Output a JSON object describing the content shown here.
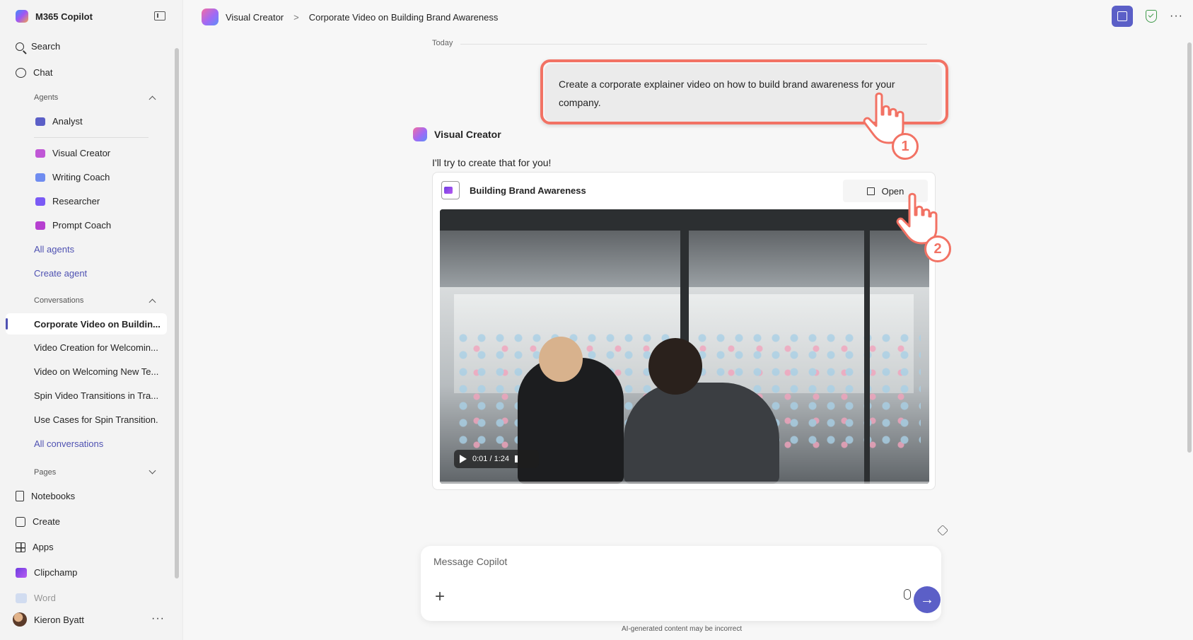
{
  "app": {
    "title": "M365 Copilot"
  },
  "nav": {
    "search": "Search",
    "chat": "Chat",
    "agents_header": "Agents",
    "agents": [
      {
        "label": "Analyst",
        "color": "#5b5fc7"
      },
      {
        "label": "Visual Creator",
        "color": "#c057d6"
      },
      {
        "label": "Writing Coach",
        "color": "#6f8cf0"
      },
      {
        "label": "Researcher",
        "color": "#7a5af5"
      },
      {
        "label": "Prompt Coach",
        "color": "#b640d0"
      }
    ],
    "all_agents": "All agents",
    "create_agent": "Create agent",
    "conversations_header": "Conversations",
    "conversations": [
      "Corporate Video on Buildin...",
      "Video Creation for Welcomin...",
      "Video on Welcoming New Te...",
      "Spin Video Transitions in Tra...",
      "Use Cases for Spin Transition..."
    ],
    "all_conversations": "All conversations",
    "pages_header": "Pages",
    "pages": [
      "Notebooks",
      "Create",
      "Apps",
      "Clipchamp",
      "Word"
    ]
  },
  "user": {
    "name": "Kieron Byatt"
  },
  "breadcrumb": {
    "agent": "Visual Creator",
    "conversation": "Corporate Video on Building Brand Awareness"
  },
  "chat": {
    "date_label": "Today",
    "user_message": "Create a corporate explainer video on how to build brand awareness for your company.",
    "bot_name": "Visual Creator",
    "bot_reply": "I'll try to create that for you!",
    "card": {
      "title": "Building Brand Awareness",
      "open_label": "Open",
      "video_time": "0:01 / 1:24"
    }
  },
  "annotations": {
    "step1": "1",
    "step2": "2"
  },
  "composer": {
    "placeholder": "Message Copilot"
  },
  "disclaimer": "AI-generated content may be incorrect",
  "colors": {
    "accent": "#5b5fc7",
    "highlight": "#f27264"
  }
}
